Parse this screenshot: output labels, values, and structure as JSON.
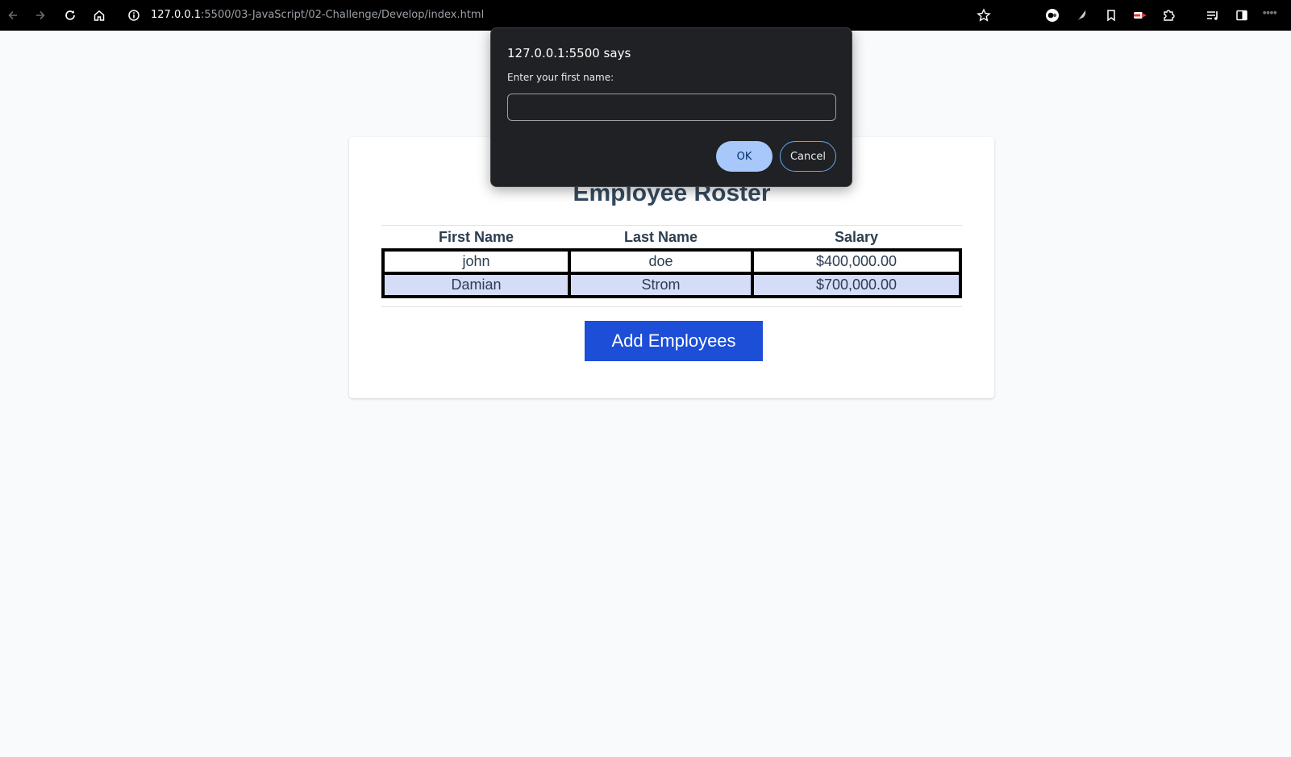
{
  "browser": {
    "url_host": "127.0.0.1",
    "url_path": ":5500/03-JavaScript/02-Challenge/Develop/index.html",
    "icons": [
      "back-arrow-icon",
      "forward-arrow-icon",
      "reload-icon",
      "home-icon",
      "site-info-icon",
      "star-icon",
      "profile-icon",
      "feather-extension-icon",
      "bookmark-icon",
      "record-extension-icon",
      "extensions-puzzle-icon",
      "reading-list-icon",
      "side-panel-icon"
    ]
  },
  "page": {
    "title": "Employee Roster",
    "table": {
      "headers": [
        "First Name",
        "Last Name",
        "Salary"
      ],
      "rows": [
        [
          "john",
          "doe",
          "$400,000.00"
        ],
        [
          "Damian",
          "Strom",
          "$700,000.00"
        ]
      ]
    },
    "add_button_label": "Add Employees"
  },
  "dialog": {
    "title": "127.0.0.1:5500 says",
    "message": "Enter your first name:",
    "input_value": "",
    "ok_label": "OK",
    "cancel_label": "Cancel"
  },
  "colors": {
    "button_blue": "#1d4ed8",
    "row_alt": "#d5dcf8",
    "dialog_bg": "#202124",
    "ok_bg": "#a8c7fa"
  }
}
